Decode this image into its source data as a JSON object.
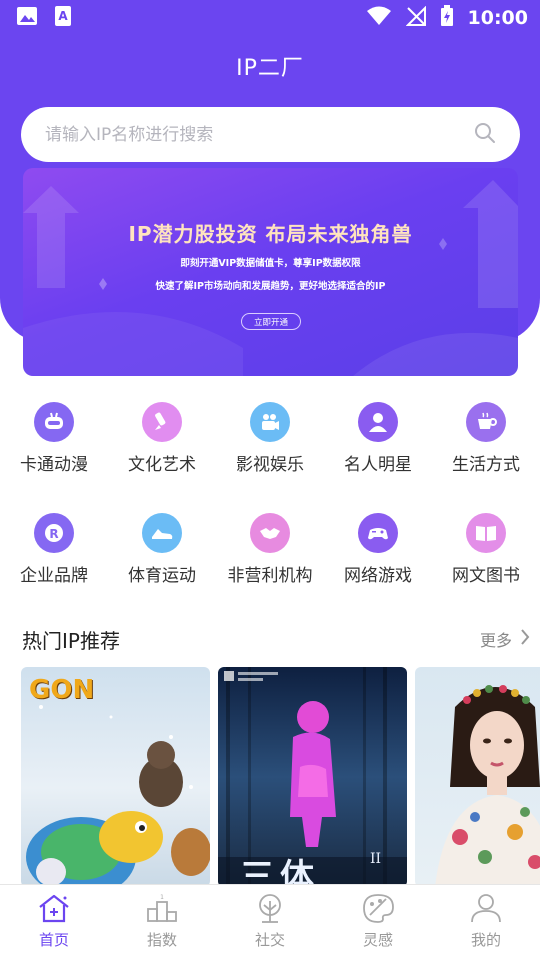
{
  "status_bar": {
    "time": "10:00"
  },
  "header": {
    "title": "IP二厂"
  },
  "search": {
    "placeholder": "请输入IP名称进行搜索"
  },
  "banner": {
    "title": "IP潜力股投资  布局未来独角兽",
    "line1": "即刻开通VIP数据储值卡，尊享IP数据权限",
    "line2": "快速了解IP市场动向和发展趋势，更好地选择适合的IP",
    "button": "立即开通"
  },
  "categories": [
    {
      "label": "卡通动漫",
      "icon": "robot-icon"
    },
    {
      "label": "文化艺术",
      "icon": "brush-icon"
    },
    {
      "label": "影视娱乐",
      "icon": "camera-icon"
    },
    {
      "label": "名人明星",
      "icon": "person-icon"
    },
    {
      "label": "生活方式",
      "icon": "cup-icon"
    },
    {
      "label": "企业品牌",
      "icon": "registered-icon"
    },
    {
      "label": "体育运动",
      "icon": "sneaker-icon"
    },
    {
      "label": "非营利机构",
      "icon": "handshake-icon"
    },
    {
      "label": "网络游戏",
      "icon": "gamepad-icon"
    },
    {
      "label": "网文图书",
      "icon": "book-icon"
    }
  ],
  "hot_section": {
    "title": "热门IP推荐",
    "more": "更多"
  },
  "hot_cards": [
    {
      "logo": "GON",
      "kind": "cartoon-animals"
    },
    {
      "title": "三体",
      "suffix": "II",
      "kind": "movie-poster"
    },
    {
      "kind": "celebrity-portrait"
    }
  ],
  "tabs": [
    {
      "label": "首页",
      "icon": "home-icon",
      "active": true
    },
    {
      "label": "指数",
      "icon": "podium-icon",
      "active": false
    },
    {
      "label": "社交",
      "icon": "tree-icon",
      "active": false
    },
    {
      "label": "灵感",
      "icon": "palette-icon",
      "active": false
    },
    {
      "label": "我的",
      "icon": "user-icon",
      "active": false
    }
  ],
  "colors": {
    "brand": "#6b45f0",
    "tab_active": "#6b45f0",
    "tab_inactive": "#999999"
  }
}
